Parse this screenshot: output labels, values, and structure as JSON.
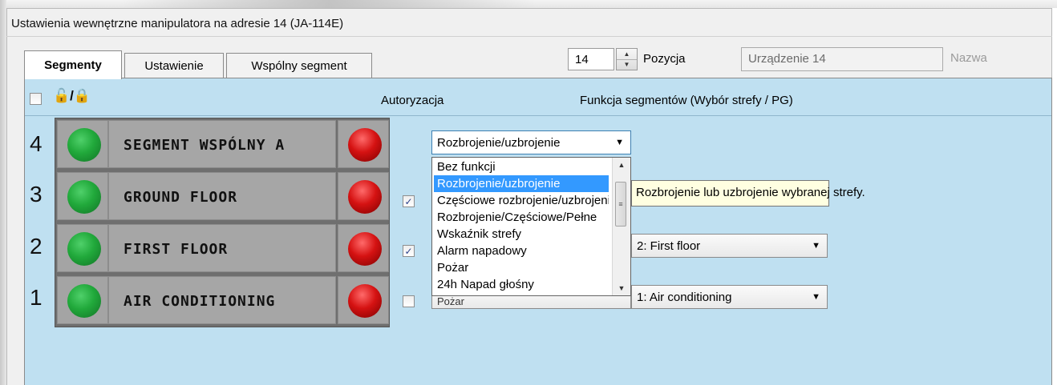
{
  "window": {
    "title": "Ustawienia wewnętrzne manipulatora na adresie 14 (JA-114E)"
  },
  "tabs": [
    {
      "label": "Segmenty",
      "active": true
    },
    {
      "label": "Ustawienie",
      "active": false
    },
    {
      "label": "Wspólny segment",
      "active": false
    }
  ],
  "position": {
    "value": "14",
    "label": "Pozycja"
  },
  "name": {
    "value": "Urządzenie 14",
    "label": "Nazwa"
  },
  "header": {
    "lock_icons": "🔓/🔒",
    "authorization_label": "Autoryzacja",
    "function_label": "Funkcja segmentów (Wybór strefy / PG)"
  },
  "segments": [
    {
      "number": "4",
      "label": "SEGMENT WSPÓLNY A",
      "authorization": null,
      "function": "Rozbrojenie/uzbrojenie",
      "zone": ""
    },
    {
      "number": "3",
      "label": "GROUND FLOOR",
      "authorization": true,
      "function": "",
      "zone": ""
    },
    {
      "number": "2",
      "label": "FIRST FLOOR",
      "authorization": true,
      "function": "",
      "zone": "2: First floor"
    },
    {
      "number": "1",
      "label": "AIR CONDITIONING",
      "authorization": false,
      "function": "Pożar",
      "zone": "1: Air conditioning"
    }
  ],
  "dropdown": {
    "options": [
      "Bez funkcji",
      "Rozbrojenie/uzbrojenie",
      "Częściowe rozbrojenie/uzbrojenie",
      "Rozbrojenie/Częściowe/Pełne",
      "Wskaźnik strefy",
      "Alarm napadowy",
      "Pożar",
      "24h Napad głośny"
    ],
    "selected": "Rozbrojenie/uzbrojenie",
    "partial_text": "Pożar"
  },
  "tooltip": {
    "text": "Rozbrojenie lub uzbrojenie wybranej strefy."
  },
  "colors": {
    "panel": "#bfe0f1",
    "led_on": "#21a93b",
    "led_alarm": "#d51212",
    "selection": "#3399ff"
  }
}
